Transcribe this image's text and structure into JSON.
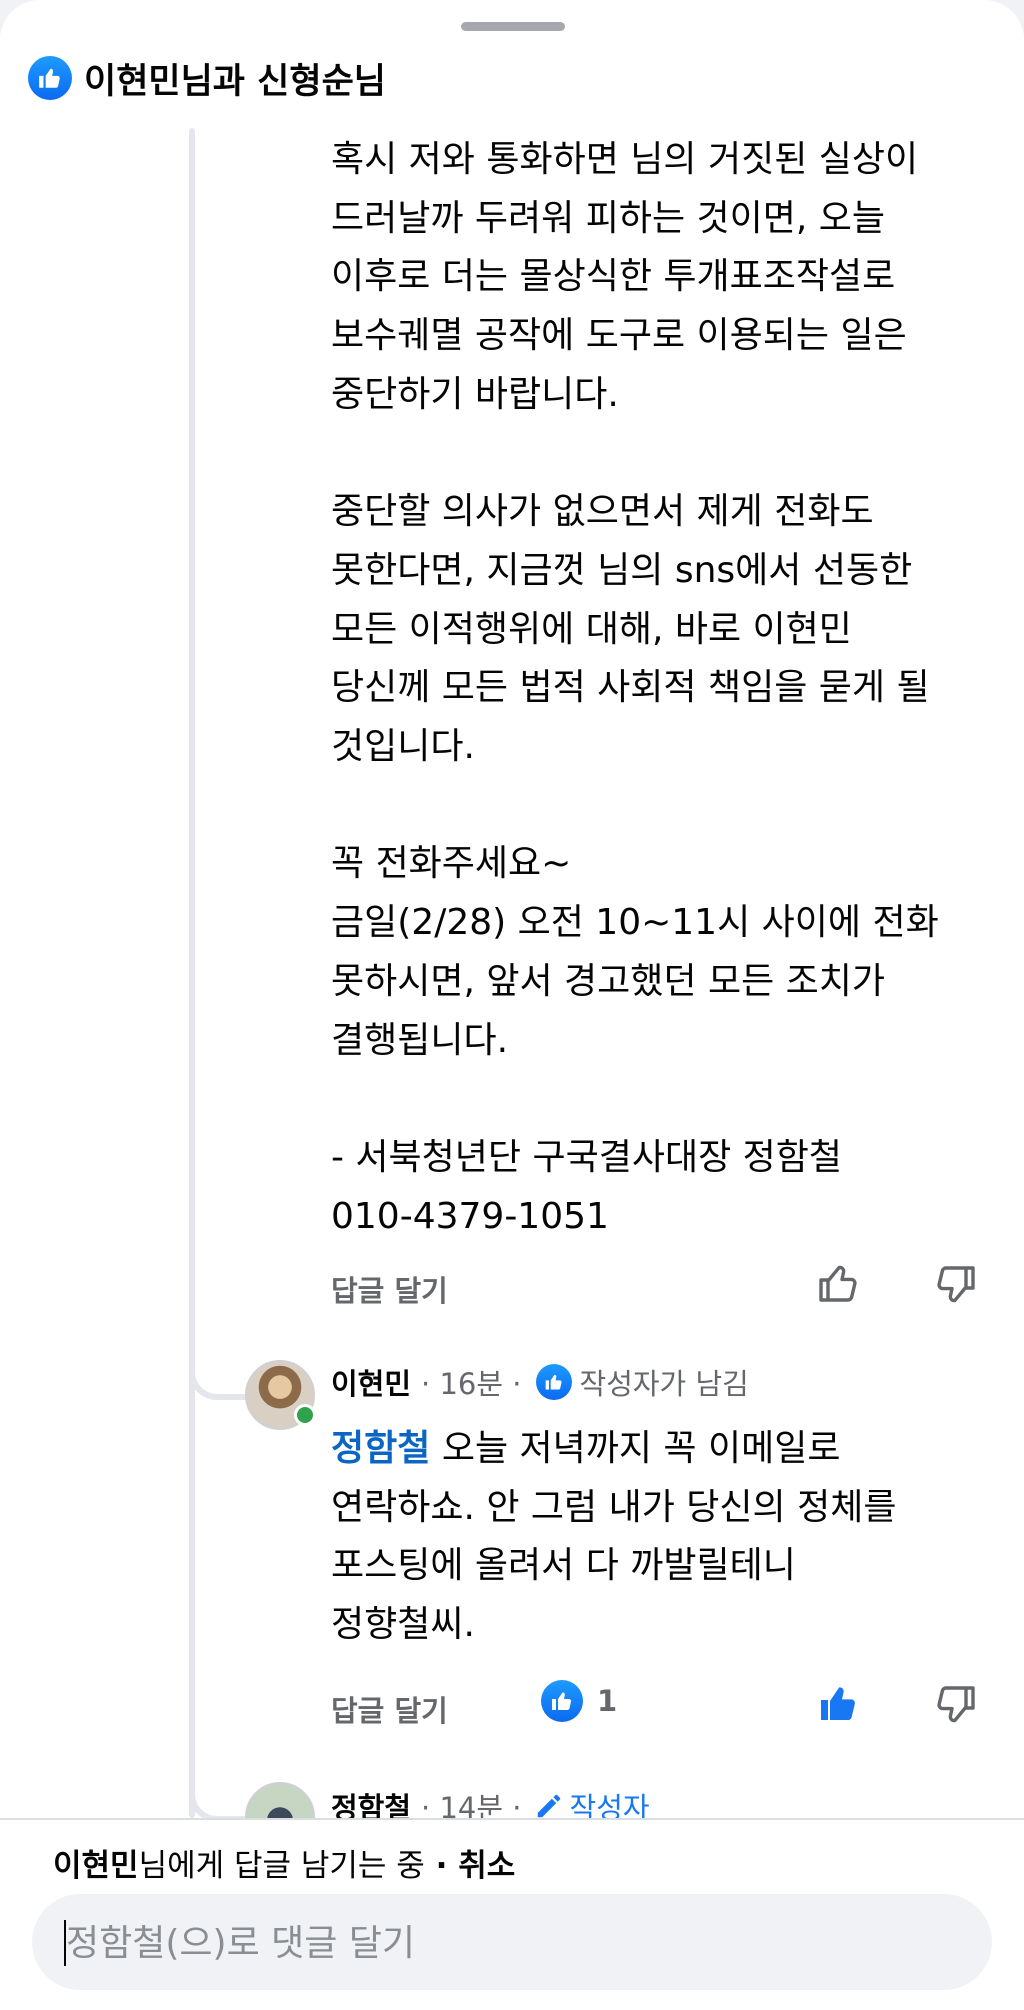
{
  "header": {
    "title": "이현민님과 신형순님"
  },
  "comment1": {
    "text": "혹시 저와 통화하면 님의 거짓된 실상이\n드러날까 두려워 피하는 것이면, 오늘\n이후로 더는 몰상식한 투개표조작설로\n보수궤멸 공작에 도구로 이용되는 일은\n중단하기 바랍니다.\n\n중단할 의사가 없으면서 제게 전화도\n못한다면, 지금껏 님의 sns에서 선동한\n모든 이적행위에 대해, 바로 이현민\n당신께 모든 법적 사회적 책임을 묻게 될\n것입니다.\n\n꼭 전화주세요~\n금일(2/28) 오전 10~11시 사이에 전화\n못하시면, 앞서 경고했던 모든 조치가\n결행됩니다.\n\n- 서북청년단 구국결사대장 정함철\n010-4379-1051",
    "reply_label": "답글 달기"
  },
  "comment2": {
    "author": "이현민",
    "time": "· 16분 ·",
    "badge": "작성자가 남김",
    "mention": "정함철",
    "text": " 오늘 저녁까지 꼭 이메일로\n연락하쇼. 안 그럼 내가 당신의 정체를\n포스팅에 올려서 다 까발릴테니\n정향철씨.",
    "reply_label": "답글 달기",
    "like_count": "1"
  },
  "comment3": {
    "author": "정함철",
    "time": "· 14분 ·",
    "badge": "작성자"
  },
  "composer": {
    "replying_to": "이현민",
    "replying_suffix": "님에게 답글 남기는 중",
    "separator": " · ",
    "cancel": "취소",
    "placeholder": "정함철(으)로 댓글 달기"
  },
  "colors": {
    "accent": "#1877f2",
    "mention": "#0a66c2",
    "secondary_text": "#65676b"
  }
}
